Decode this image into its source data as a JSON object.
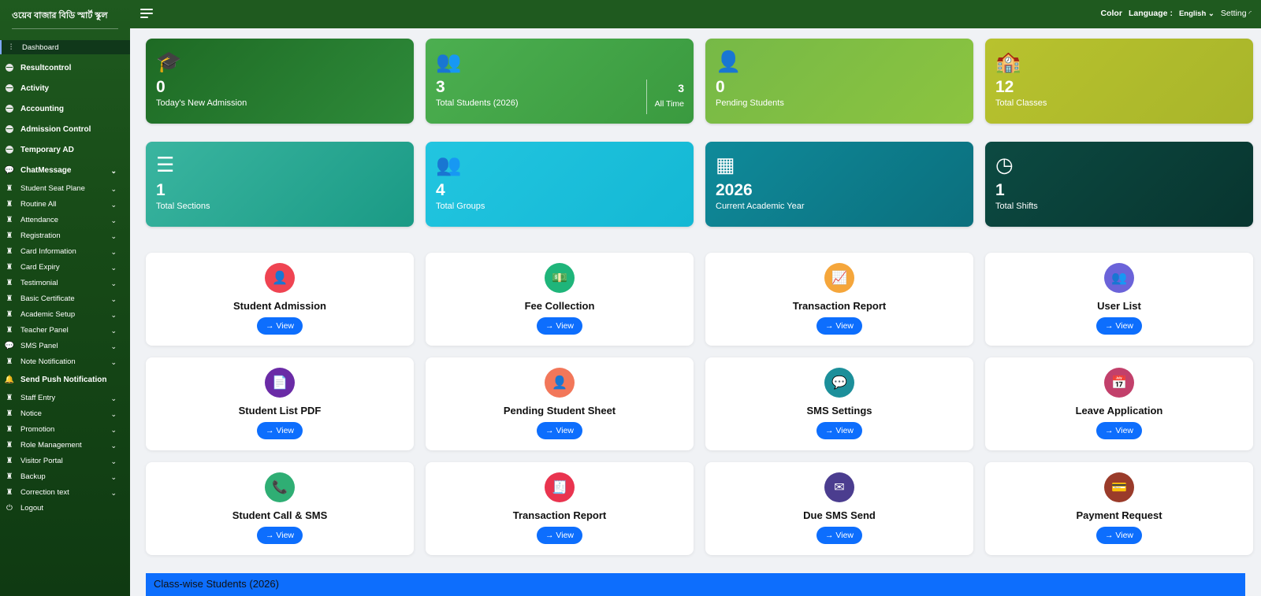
{
  "brand": {
    "title": "ওয়েব বাজার বিডি স্মার্ট স্কুল"
  },
  "sidebar": {
    "items": [
      {
        "label": "Dashboard",
        "icon": "sliders-icon",
        "style": "active",
        "chevron": false
      },
      {
        "label": "Resultcontrol",
        "icon": "globe-icon",
        "style": "bold",
        "chevron": false
      },
      {
        "label": "Activity",
        "icon": "globe-icon",
        "style": "bold",
        "chevron": false
      },
      {
        "label": "Accounting",
        "icon": "globe-icon",
        "style": "bold",
        "chevron": false
      },
      {
        "label": "Admission Control",
        "icon": "globe-icon",
        "style": "bold",
        "chevron": false
      },
      {
        "label": "Temporary AD",
        "icon": "globe-icon",
        "style": "bold",
        "chevron": false
      },
      {
        "label": "ChatMessage",
        "icon": "chat-icon",
        "style": "bold",
        "chevron": true
      },
      {
        "label": "Student Seat Plane",
        "icon": "user-graduate-icon",
        "style": "normal",
        "chevron": true
      },
      {
        "label": "Routine All",
        "icon": "user-graduate-icon",
        "style": "normal",
        "chevron": true
      },
      {
        "label": "Attendance",
        "icon": "user-graduate-icon",
        "style": "normal",
        "chevron": true
      },
      {
        "label": "Registration",
        "icon": "user-graduate-icon",
        "style": "normal",
        "chevron": true
      },
      {
        "label": "Card Information",
        "icon": "user-graduate-icon",
        "style": "normal",
        "chevron": true
      },
      {
        "label": "Card Expiry",
        "icon": "user-graduate-icon",
        "style": "normal",
        "chevron": true
      },
      {
        "label": "Testimonial",
        "icon": "user-graduate-icon",
        "style": "normal",
        "chevron": true
      },
      {
        "label": "Basic Certificate",
        "icon": "user-graduate-icon",
        "style": "normal",
        "chevron": true
      },
      {
        "label": "Academic Setup",
        "icon": "user-graduate-icon",
        "style": "normal",
        "chevron": true
      },
      {
        "label": "Teacher Panel",
        "icon": "user-graduate-icon",
        "style": "normal",
        "chevron": true
      },
      {
        "label": "SMS Panel",
        "icon": "comment-icon",
        "style": "normal",
        "chevron": true
      },
      {
        "label": "Note Notification",
        "icon": "user-graduate-icon",
        "style": "normal",
        "chevron": true
      },
      {
        "label": "Send Push Notification",
        "icon": "bell-icon",
        "style": "bold",
        "chevron": false
      },
      {
        "label": "Staff Entry",
        "icon": "user-graduate-icon",
        "style": "normal",
        "chevron": true
      },
      {
        "label": "Notice",
        "icon": "user-graduate-icon",
        "style": "normal",
        "chevron": true
      },
      {
        "label": "Promotion",
        "icon": "user-graduate-icon",
        "style": "normal",
        "chevron": true
      },
      {
        "label": "Role Management",
        "icon": "user-graduate-icon",
        "style": "normal",
        "chevron": true
      },
      {
        "label": "Visitor Portal",
        "icon": "user-graduate-icon",
        "style": "normal",
        "chevron": true
      },
      {
        "label": "Backup",
        "icon": "user-graduate-icon",
        "style": "normal",
        "chevron": true
      },
      {
        "label": "Correction text",
        "icon": "user-graduate-icon",
        "style": "normal",
        "chevron": true
      },
      {
        "label": "Logout",
        "icon": "power-icon",
        "style": "normal",
        "chevron": false
      }
    ]
  },
  "topbar": {
    "color_label": "Color",
    "language_label": "Language :",
    "language_value": "English",
    "setting_label": "Setting"
  },
  "stats": [
    {
      "value": "0",
      "label": "Today's New Admission",
      "icon": "graduate-icon",
      "glyph": "🎓",
      "colors": [
        "#1e6a24",
        "#2e8b3a"
      ]
    },
    {
      "value": "3",
      "label": "Total Students (2026)",
      "icon": "users-icon",
      "glyph": "👥",
      "colors": [
        "#4caf50",
        "#3a9a3f"
      ],
      "side_value": "3",
      "side_label": "All Time"
    },
    {
      "value": "0",
      "label": "Pending Students",
      "icon": "user-clock-icon",
      "glyph": "👤",
      "colors": [
        "#76b947",
        "#8cc43f"
      ]
    },
    {
      "value": "12",
      "label": "Total Classes",
      "icon": "school-icon",
      "glyph": "🏫",
      "colors": [
        "#b8c22e",
        "#a8b52a"
      ]
    },
    {
      "value": "1",
      "label": "Total Sections",
      "icon": "layers-icon",
      "glyph": "☰",
      "colors": [
        "#3ab5a0",
        "#1a9a85"
      ]
    },
    {
      "value": "4",
      "label": "Total Groups",
      "icon": "people-group-icon",
      "glyph": "👥",
      "colors": [
        "#22c5e0",
        "#14b8d4"
      ]
    },
    {
      "value": "2026",
      "label": "Current Academic Year",
      "icon": "calendar-icon",
      "glyph": "▦",
      "colors": [
        "#0f8a9a",
        "#0b6f7d"
      ]
    },
    {
      "value": "1",
      "label": "Total Shifts",
      "icon": "clock-icon",
      "glyph": "◷",
      "colors": [
        "#0c4a42",
        "#08352f"
      ]
    }
  ],
  "features": [
    {
      "title": "Student Admission",
      "icon": "user-plus-icon",
      "glyph": "👤",
      "color": "#ef4452",
      "button": "→ View"
    },
    {
      "title": "Fee Collection",
      "icon": "money-icon",
      "glyph": "💵",
      "color": "#1fb57a",
      "button": "→ View"
    },
    {
      "title": "Transaction Report",
      "icon": "chart-line-icon",
      "glyph": "📈",
      "color": "#f5a63b",
      "button": "→ View"
    },
    {
      "title": "User List",
      "icon": "users-gear-icon",
      "glyph": "👥",
      "color": "#6b63d9",
      "button": "→ View"
    },
    {
      "title": "Student List PDF",
      "icon": "pdf-icon",
      "glyph": "📄",
      "color": "#6a2ba6",
      "button": "→ View"
    },
    {
      "title": "Pending Student Sheet",
      "icon": "user-clock-icon",
      "glyph": "👤",
      "color": "#f2775a",
      "button": "→ View"
    },
    {
      "title": "SMS Settings",
      "icon": "sms-icon",
      "glyph": "💬",
      "color": "#1c8f9a",
      "button": "→ View"
    },
    {
      "title": "Leave Application",
      "icon": "calendar-minus-icon",
      "glyph": "📅",
      "color": "#c2406b",
      "button": "→ View"
    },
    {
      "title": "Student Call & SMS",
      "icon": "phone-icon",
      "glyph": "📞",
      "color": "#2fae74",
      "button": "→ View"
    },
    {
      "title": "Transaction Report",
      "icon": "file-invoice-icon",
      "glyph": "🧾",
      "color": "#e9344f",
      "button": "→ View"
    },
    {
      "title": "Due SMS Send",
      "icon": "envelope-open-icon",
      "glyph": "✉",
      "color": "#4b3d8f",
      "button": "→ View"
    },
    {
      "title": "Payment Request",
      "icon": "money-check-icon",
      "glyph": "💳",
      "color": "#9a3b2a",
      "button": "→ View"
    }
  ],
  "section": {
    "title": "Class-wise Students (2026)"
  }
}
